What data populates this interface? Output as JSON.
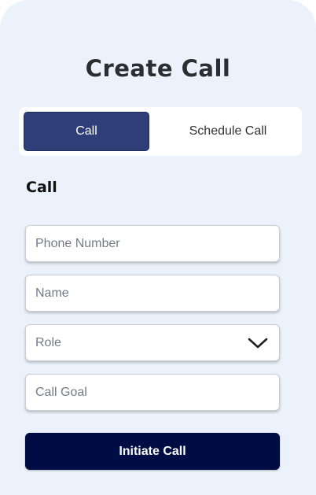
{
  "page": {
    "title": "Create Call"
  },
  "tabs": [
    {
      "label": "Call",
      "active": true
    },
    {
      "label": "Schedule Call",
      "active": false
    }
  ],
  "form": {
    "heading": "Call",
    "phone": {
      "placeholder": "Phone Number",
      "value": ""
    },
    "name": {
      "placeholder": "Name",
      "value": ""
    },
    "role": {
      "selected": "Role",
      "icon": "chevron-down-icon"
    },
    "goal": {
      "placeholder": "Call Goal",
      "value": ""
    },
    "submit_label": "Initiate Call"
  },
  "colors": {
    "background": "#ecf2fb",
    "tab_active": "#2e3f78",
    "submit": "#000d44"
  }
}
